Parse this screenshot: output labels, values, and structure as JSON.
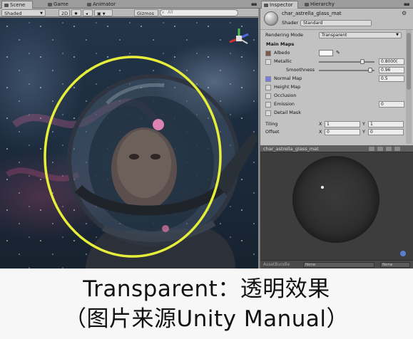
{
  "tabs": {
    "scene": "Scene",
    "game": "Game",
    "animator": "Animator",
    "inspector": "Inspector",
    "hierarchy": "Hierarchy"
  },
  "scene_toolbar": {
    "shading": "Shaded",
    "mode_2d": "2D",
    "gizmos": "Gizmos",
    "search_placeholder": "All"
  },
  "inspector": {
    "material_name": "char_astrella_glass_mat",
    "shader_label": "Shader",
    "shader_value": "Standard",
    "rendering_mode_label": "Rendering Mode",
    "rendering_mode_value": "Transparent",
    "main_maps_label": "Main Maps",
    "albedo_label": "Albedo",
    "metallic_label": "Metallic",
    "metallic_value": "0.8000(",
    "metallic_level": 0.8,
    "smoothness_label": "Smoothness",
    "smoothness_value": "0.96",
    "smoothness_level": 0.96,
    "normal_map_label": "Normal Map",
    "normal_map_value": "0.5",
    "height_map_label": "Height Map",
    "occlusion_label": "Occlusion",
    "emission_label": "Emission",
    "emission_value": "0",
    "detail_mask_label": "Detail Mask",
    "tiling_label": "Tiling",
    "offset_label": "Offset",
    "tiling_x": "1",
    "tiling_y": "1",
    "offset_x": "0",
    "offset_y": "0",
    "x_label": "X",
    "y_label": "Y",
    "albedo_color": "#fafafa",
    "normal_map_color": "#7a7ae8"
  },
  "preview": {
    "title": "char_astrella_glass_mat",
    "assetbundle_label": "AssetBundle",
    "assetbundle_value": "None",
    "variant_value": "None"
  },
  "caption": {
    "line1": "Transparent：透明效果",
    "line2": "（图片来源Unity Manual）"
  },
  "colors": {
    "highlight_circle": "#e6ee3a",
    "editor_gray": "#c2c2c2",
    "gizmo_red": "#d33030",
    "gizmo_green": "#4fbf4f",
    "gizmo_blue": "#4f6fe0"
  },
  "icons": [
    "scene-tab-icon",
    "game-tab-icon",
    "animator-tab-icon",
    "inspector-tab-icon",
    "hierarchy-tab-icon",
    "scene-gizmo-icon",
    "eyedropper-icon",
    "play-preview-icon",
    "lock-icon"
  ]
}
